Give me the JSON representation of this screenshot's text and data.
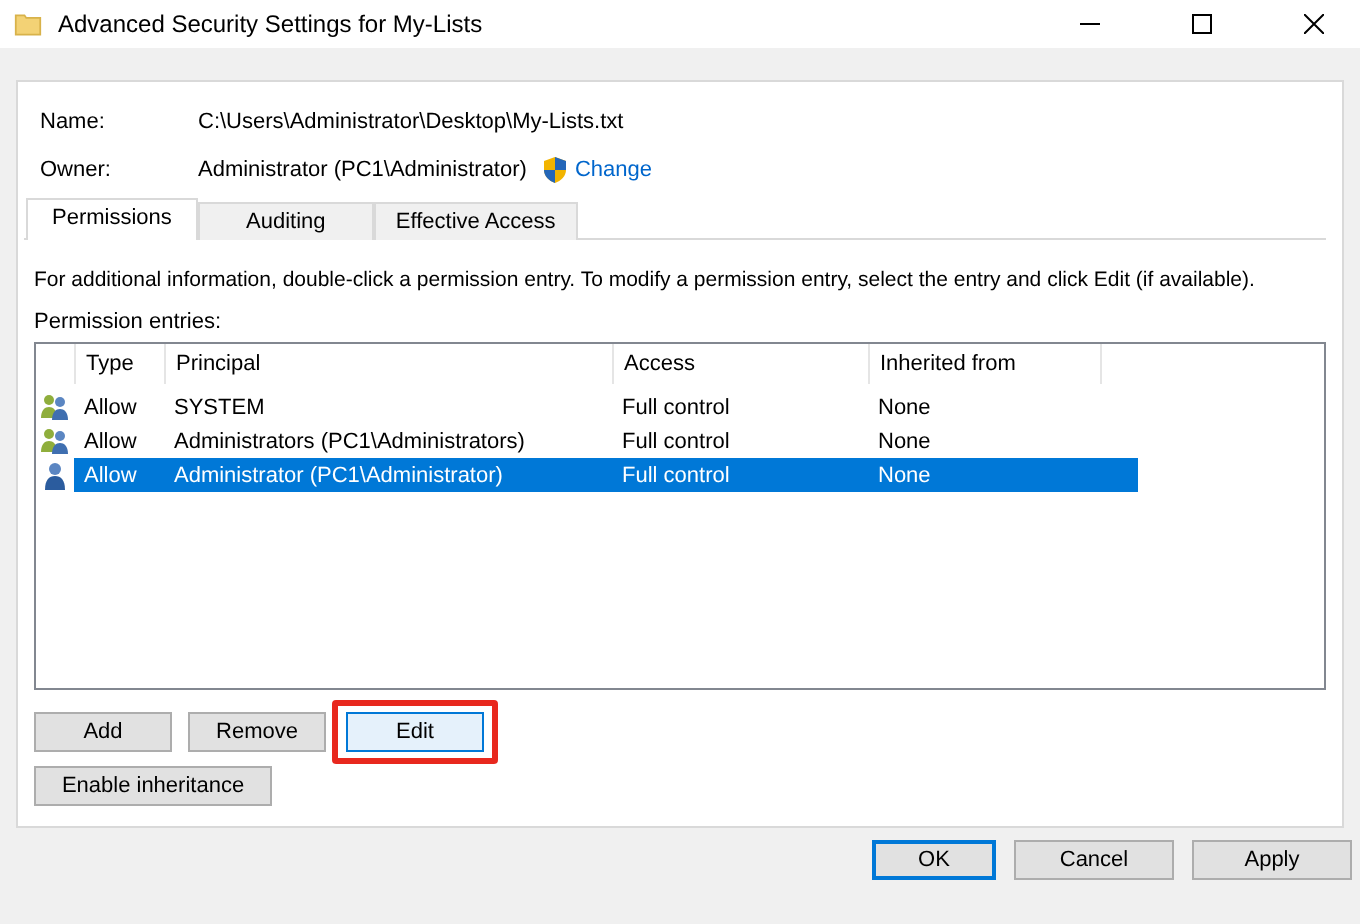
{
  "window": {
    "title": "Advanced Security Settings for My-Lists"
  },
  "details": [
    {
      "label": "Name:",
      "value": "C:\\Users\\Administrator\\Desktop\\My-Lists.txt"
    },
    {
      "label": "Owner:",
      "value": "Administrator (PC1\\Administrator)",
      "link": "Change"
    }
  ],
  "tabs": [
    {
      "label": "Permissions",
      "selected": true
    },
    {
      "label": "Auditing",
      "selected": false
    },
    {
      "label": "Effective Access",
      "selected": false
    }
  ],
  "info_text": "For additional information, double-click a permission entry. To modify a permission entry, select the entry and click Edit (if available).",
  "entries_label": "Permission entries:",
  "table": {
    "columns": [
      "Type",
      "Principal",
      "Access",
      "Inherited from"
    ],
    "rows": [
      {
        "kind": "group",
        "cells": [
          "Allow",
          "SYSTEM",
          "Full control",
          "None"
        ],
        "selected": false
      },
      {
        "kind": "group",
        "cells": [
          "Allow",
          "Administrators (PC1\\Administrators)",
          "Full control",
          "None"
        ],
        "selected": false
      },
      {
        "kind": "user",
        "cells": [
          "Allow",
          "Administrator (PC1\\Administrator)",
          "Full control",
          "None"
        ],
        "selected": true
      }
    ]
  },
  "entry_buttons": [
    {
      "label": "Add",
      "highlighted": false
    },
    {
      "label": "Remove",
      "highlighted": false
    },
    {
      "label": "Edit",
      "highlighted": true
    }
  ],
  "inheritance_button": "Enable inheritance",
  "dialog_buttons": [
    {
      "label": "OK",
      "default": true
    },
    {
      "label": "Cancel",
      "default": false
    },
    {
      "label": "Apply",
      "default": false
    }
  ]
}
